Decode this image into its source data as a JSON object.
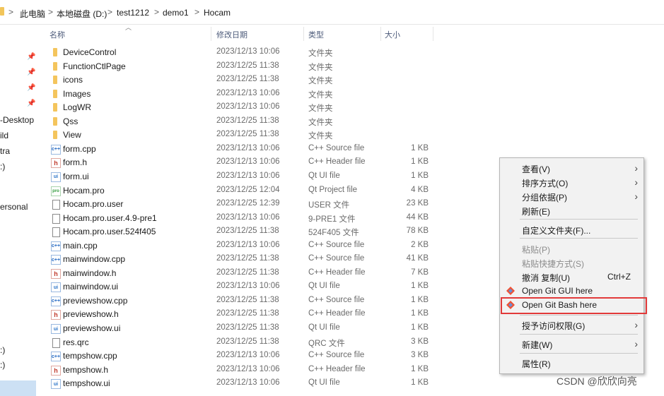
{
  "breadcrumb": {
    "items": [
      "此电脑",
      "本地磁盘 (D:)",
      "test1212",
      "demo1",
      "Hocam"
    ],
    "separator": ">"
  },
  "sidebar": {
    "items": [
      "-Desktop",
      "ild",
      "tra",
      ":)",
      "ersonal",
      ":)",
      ":)"
    ]
  },
  "columns": {
    "name": "名称",
    "date": "修改日期",
    "type": "类型",
    "size": "大小"
  },
  "files": [
    {
      "icon": "folder-icon",
      "name": "DeviceControl",
      "date": "2023/12/13 10:06",
      "type": "文件夹",
      "size": ""
    },
    {
      "icon": "folder-icon",
      "name": "FunctionCtlPage",
      "date": "2023/12/25 11:38",
      "type": "文件夹",
      "size": ""
    },
    {
      "icon": "folder-icon",
      "name": "icons",
      "date": "2023/12/25 11:38",
      "type": "文件夹",
      "size": ""
    },
    {
      "icon": "folder-icon",
      "name": "Images",
      "date": "2023/12/13 10:06",
      "type": "文件夹",
      "size": ""
    },
    {
      "icon": "folder-icon",
      "name": "LogWR",
      "date": "2023/12/13 10:06",
      "type": "文件夹",
      "size": ""
    },
    {
      "icon": "folder-icon",
      "name": "Qss",
      "date": "2023/12/25 11:38",
      "type": "文件夹",
      "size": ""
    },
    {
      "icon": "folder-icon",
      "name": "View",
      "date": "2023/12/25 11:38",
      "type": "文件夹",
      "size": ""
    },
    {
      "icon": "cpp-file-icon",
      "name": "form.cpp",
      "date": "2023/12/13 10:06",
      "type": "C++ Source file",
      "size": "1 KB"
    },
    {
      "icon": "header-file-icon",
      "name": "form.h",
      "date": "2023/12/13 10:06",
      "type": "C++ Header file",
      "size": "1 KB"
    },
    {
      "icon": "qt-ui-file-icon",
      "name": "form.ui",
      "date": "2023/12/13 10:06",
      "type": "Qt UI file",
      "size": "1 KB"
    },
    {
      "icon": "qt-project-file-icon",
      "name": "Hocam.pro",
      "date": "2023/12/25 12:04",
      "type": "Qt Project file",
      "size": "4 KB"
    },
    {
      "icon": "document-icon",
      "name": "Hocam.pro.user",
      "date": "2023/12/25 12:39",
      "type": "USER 文件",
      "size": "23 KB"
    },
    {
      "icon": "document-icon",
      "name": "Hocam.pro.user.4.9-pre1",
      "date": "2023/12/13 10:06",
      "type": "9-PRE1 文件",
      "size": "44 KB"
    },
    {
      "icon": "document-icon",
      "name": "Hocam.pro.user.524f405",
      "date": "2023/12/25 11:38",
      "type": "524F405 文件",
      "size": "78 KB"
    },
    {
      "icon": "cpp-file-icon",
      "name": "main.cpp",
      "date": "2023/12/13 10:06",
      "type": "C++ Source file",
      "size": "2 KB"
    },
    {
      "icon": "cpp-file-icon",
      "name": "mainwindow.cpp",
      "date": "2023/12/25 11:38",
      "type": "C++ Source file",
      "size": "41 KB"
    },
    {
      "icon": "header-file-icon",
      "name": "mainwindow.h",
      "date": "2023/12/25 11:38",
      "type": "C++ Header file",
      "size": "7 KB"
    },
    {
      "icon": "qt-ui-file-icon",
      "name": "mainwindow.ui",
      "date": "2023/12/13 10:06",
      "type": "Qt UI file",
      "size": "1 KB"
    },
    {
      "icon": "cpp-file-icon",
      "name": "previewshow.cpp",
      "date": "2023/12/25 11:38",
      "type": "C++ Source file",
      "size": "1 KB"
    },
    {
      "icon": "header-file-icon",
      "name": "previewshow.h",
      "date": "2023/12/25 11:38",
      "type": "C++ Header file",
      "size": "1 KB"
    },
    {
      "icon": "qt-ui-file-icon",
      "name": "previewshow.ui",
      "date": "2023/12/25 11:38",
      "type": "Qt UI file",
      "size": "1 KB"
    },
    {
      "icon": "document-icon",
      "name": "res.qrc",
      "date": "2023/12/25 11:38",
      "type": "QRC 文件",
      "size": "3 KB"
    },
    {
      "icon": "cpp-file-icon",
      "name": "tempshow.cpp",
      "date": "2023/12/13 10:06",
      "type": "C++ Source file",
      "size": "3 KB"
    },
    {
      "icon": "header-file-icon",
      "name": "tempshow.h",
      "date": "2023/12/13 10:06",
      "type": "C++ Header file",
      "size": "1 KB"
    },
    {
      "icon": "qt-ui-file-icon",
      "name": "tempshow.ui",
      "date": "2023/12/13 10:06",
      "type": "Qt UI file",
      "size": "1 KB"
    }
  ],
  "context_menu": {
    "view": "查看(V)",
    "sort": "排序方式(O)",
    "group": "分组依据(P)",
    "refresh": "刷新(E)",
    "customize": "自定义文件夹(F)...",
    "paste": "粘贴(P)",
    "paste_shortcut": "粘贴快捷方式(S)",
    "undo_copy": "撤消 复制(U)",
    "undo_shortcut": "Ctrl+Z",
    "git_gui": "Open Git GUI here",
    "git_bash": "Open Git Bash here",
    "grant_access": "授予访问权限(G)",
    "new": "新建(W)",
    "properties": "属性(R)"
  },
  "watermark": "CSDN @欣欣向亮",
  "colors": {
    "folder": "#f4c55d",
    "highlight_box": "#e23a3a",
    "menu_bg": "#f2f2f2",
    "selected_nav": "#cce0f4"
  }
}
